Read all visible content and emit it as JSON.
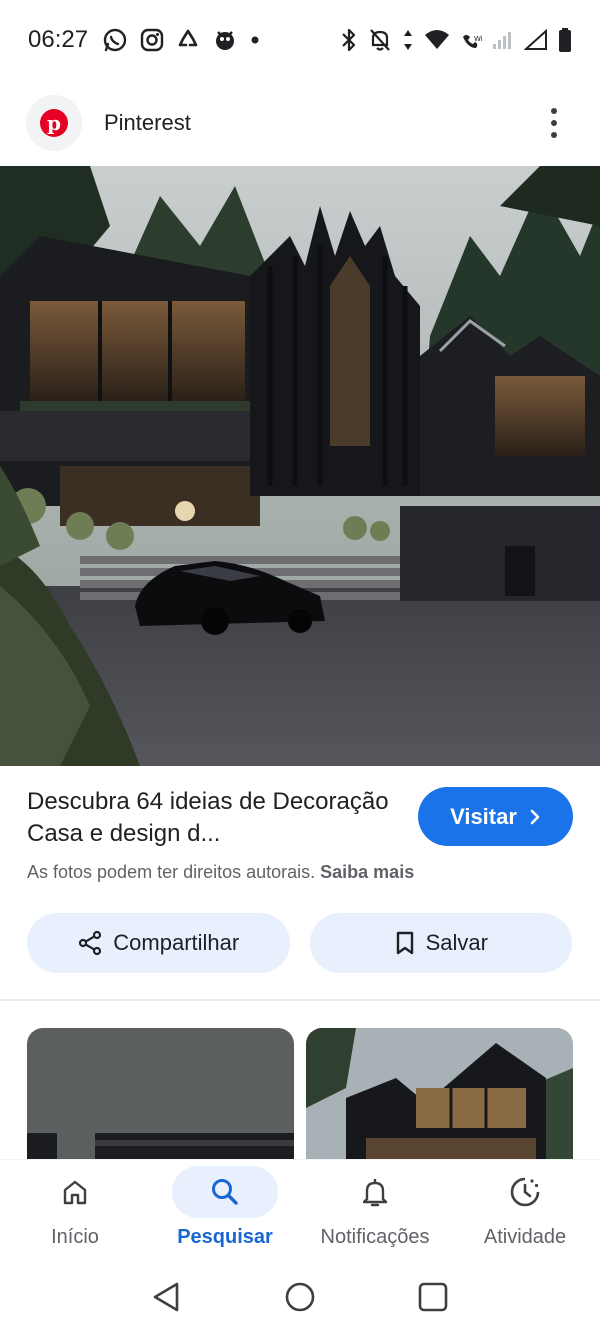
{
  "status_bar": {
    "time": "06:27",
    "left_icons": [
      "whatsapp-icon",
      "instagram-icon",
      "recycle-icon",
      "bug-icon",
      "dot-icon"
    ],
    "right_icons": [
      "bluetooth-icon",
      "bell-off-icon",
      "data-icon",
      "wifi-icon",
      "wifi-call-icon",
      "signal-icon",
      "signal-empty-icon",
      "battery-icon"
    ]
  },
  "source": {
    "name": "Pinterest",
    "logo_color": "#e60023"
  },
  "hero": {
    "icon": "house-photo"
  },
  "info": {
    "title": "Descubra 64 ideias de Decoração Casa e design d...",
    "visit_label": "Visitar",
    "copyright_text": "As fotos podem ter direitos autorais.",
    "learn_more": "Saiba mais",
    "share_label": "Compartilhar",
    "save_label": "Salvar"
  },
  "bottom_nav": {
    "items": [
      {
        "label": "Início",
        "icon": "home-icon",
        "active": false
      },
      {
        "label": "Pesquisar",
        "icon": "search-icon",
        "active": true
      },
      {
        "label": "Notificações",
        "icon": "bell-icon",
        "active": false
      },
      {
        "label": "Atividade",
        "icon": "activity-icon",
        "active": false
      }
    ]
  },
  "colors": {
    "accent": "#1a73e8",
    "active_pill": "#e8f0fe",
    "active_label": "#1967d2"
  }
}
